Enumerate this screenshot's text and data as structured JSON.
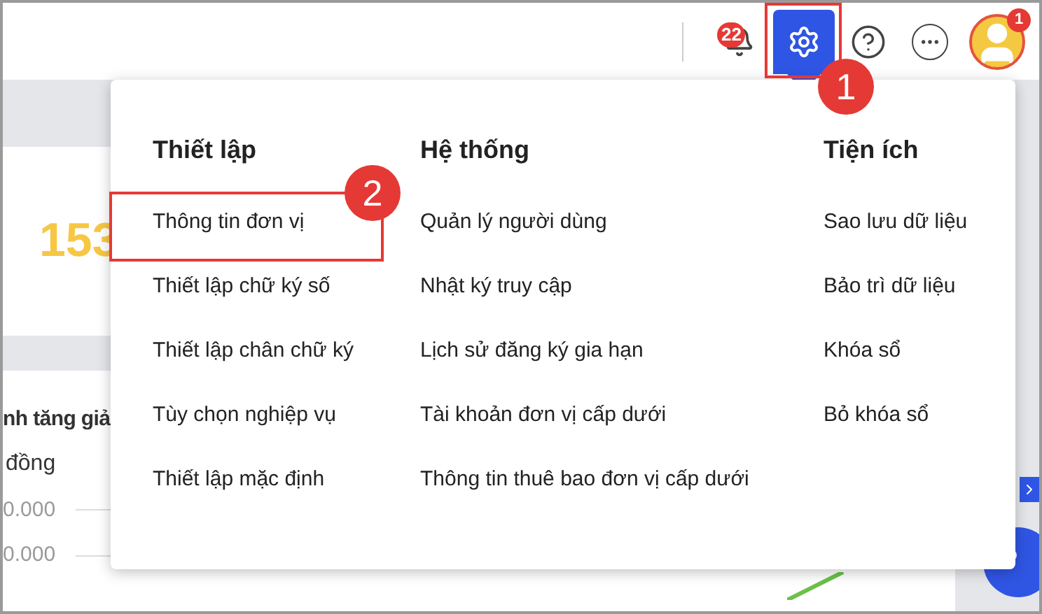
{
  "toolbar": [
    {
      "kind": "notifications",
      "selected": false,
      "badge": "22"
    },
    {
      "kind": "settings",
      "selected": true
    },
    {
      "kind": "help",
      "selected": false
    },
    {
      "kind": "more",
      "selected": false
    },
    {
      "kind": "avatar",
      "selected": false,
      "badge": "1"
    }
  ],
  "summary_card": {
    "value": "153"
  },
  "chart_card": {
    "title": "nh tăng giả",
    "unit": "đồng",
    "ticks": [
      "0.000",
      "0.000"
    ]
  },
  "menu": {
    "columns": [
      {
        "title": "Thiết lập",
        "items": [
          "Thông tin đơn vị",
          "Thiết lập chữ ký số",
          "Thiết lập chân chữ ký",
          "Tùy chọn nghiệp vụ",
          "Thiết lập mặc định"
        ]
      },
      {
        "title": "Hệ thống",
        "items": [
          "Quản lý người dùng",
          "Nhật ký truy cập",
          "Lịch sử đăng ký gia hạn",
          "Tài khoản đơn vị cấp dưới",
          "Thông tin thuê bao đơn vị cấp dưới"
        ]
      },
      {
        "title": "Tiện ích",
        "items": [
          "Sao lưu dữ liệu",
          "Bảo trì dữ liệu",
          "Khóa sổ",
          "Bỏ khóa sổ"
        ]
      }
    ]
  },
  "annotations": [
    {
      "label": "1"
    },
    {
      "label": "2"
    }
  ]
}
